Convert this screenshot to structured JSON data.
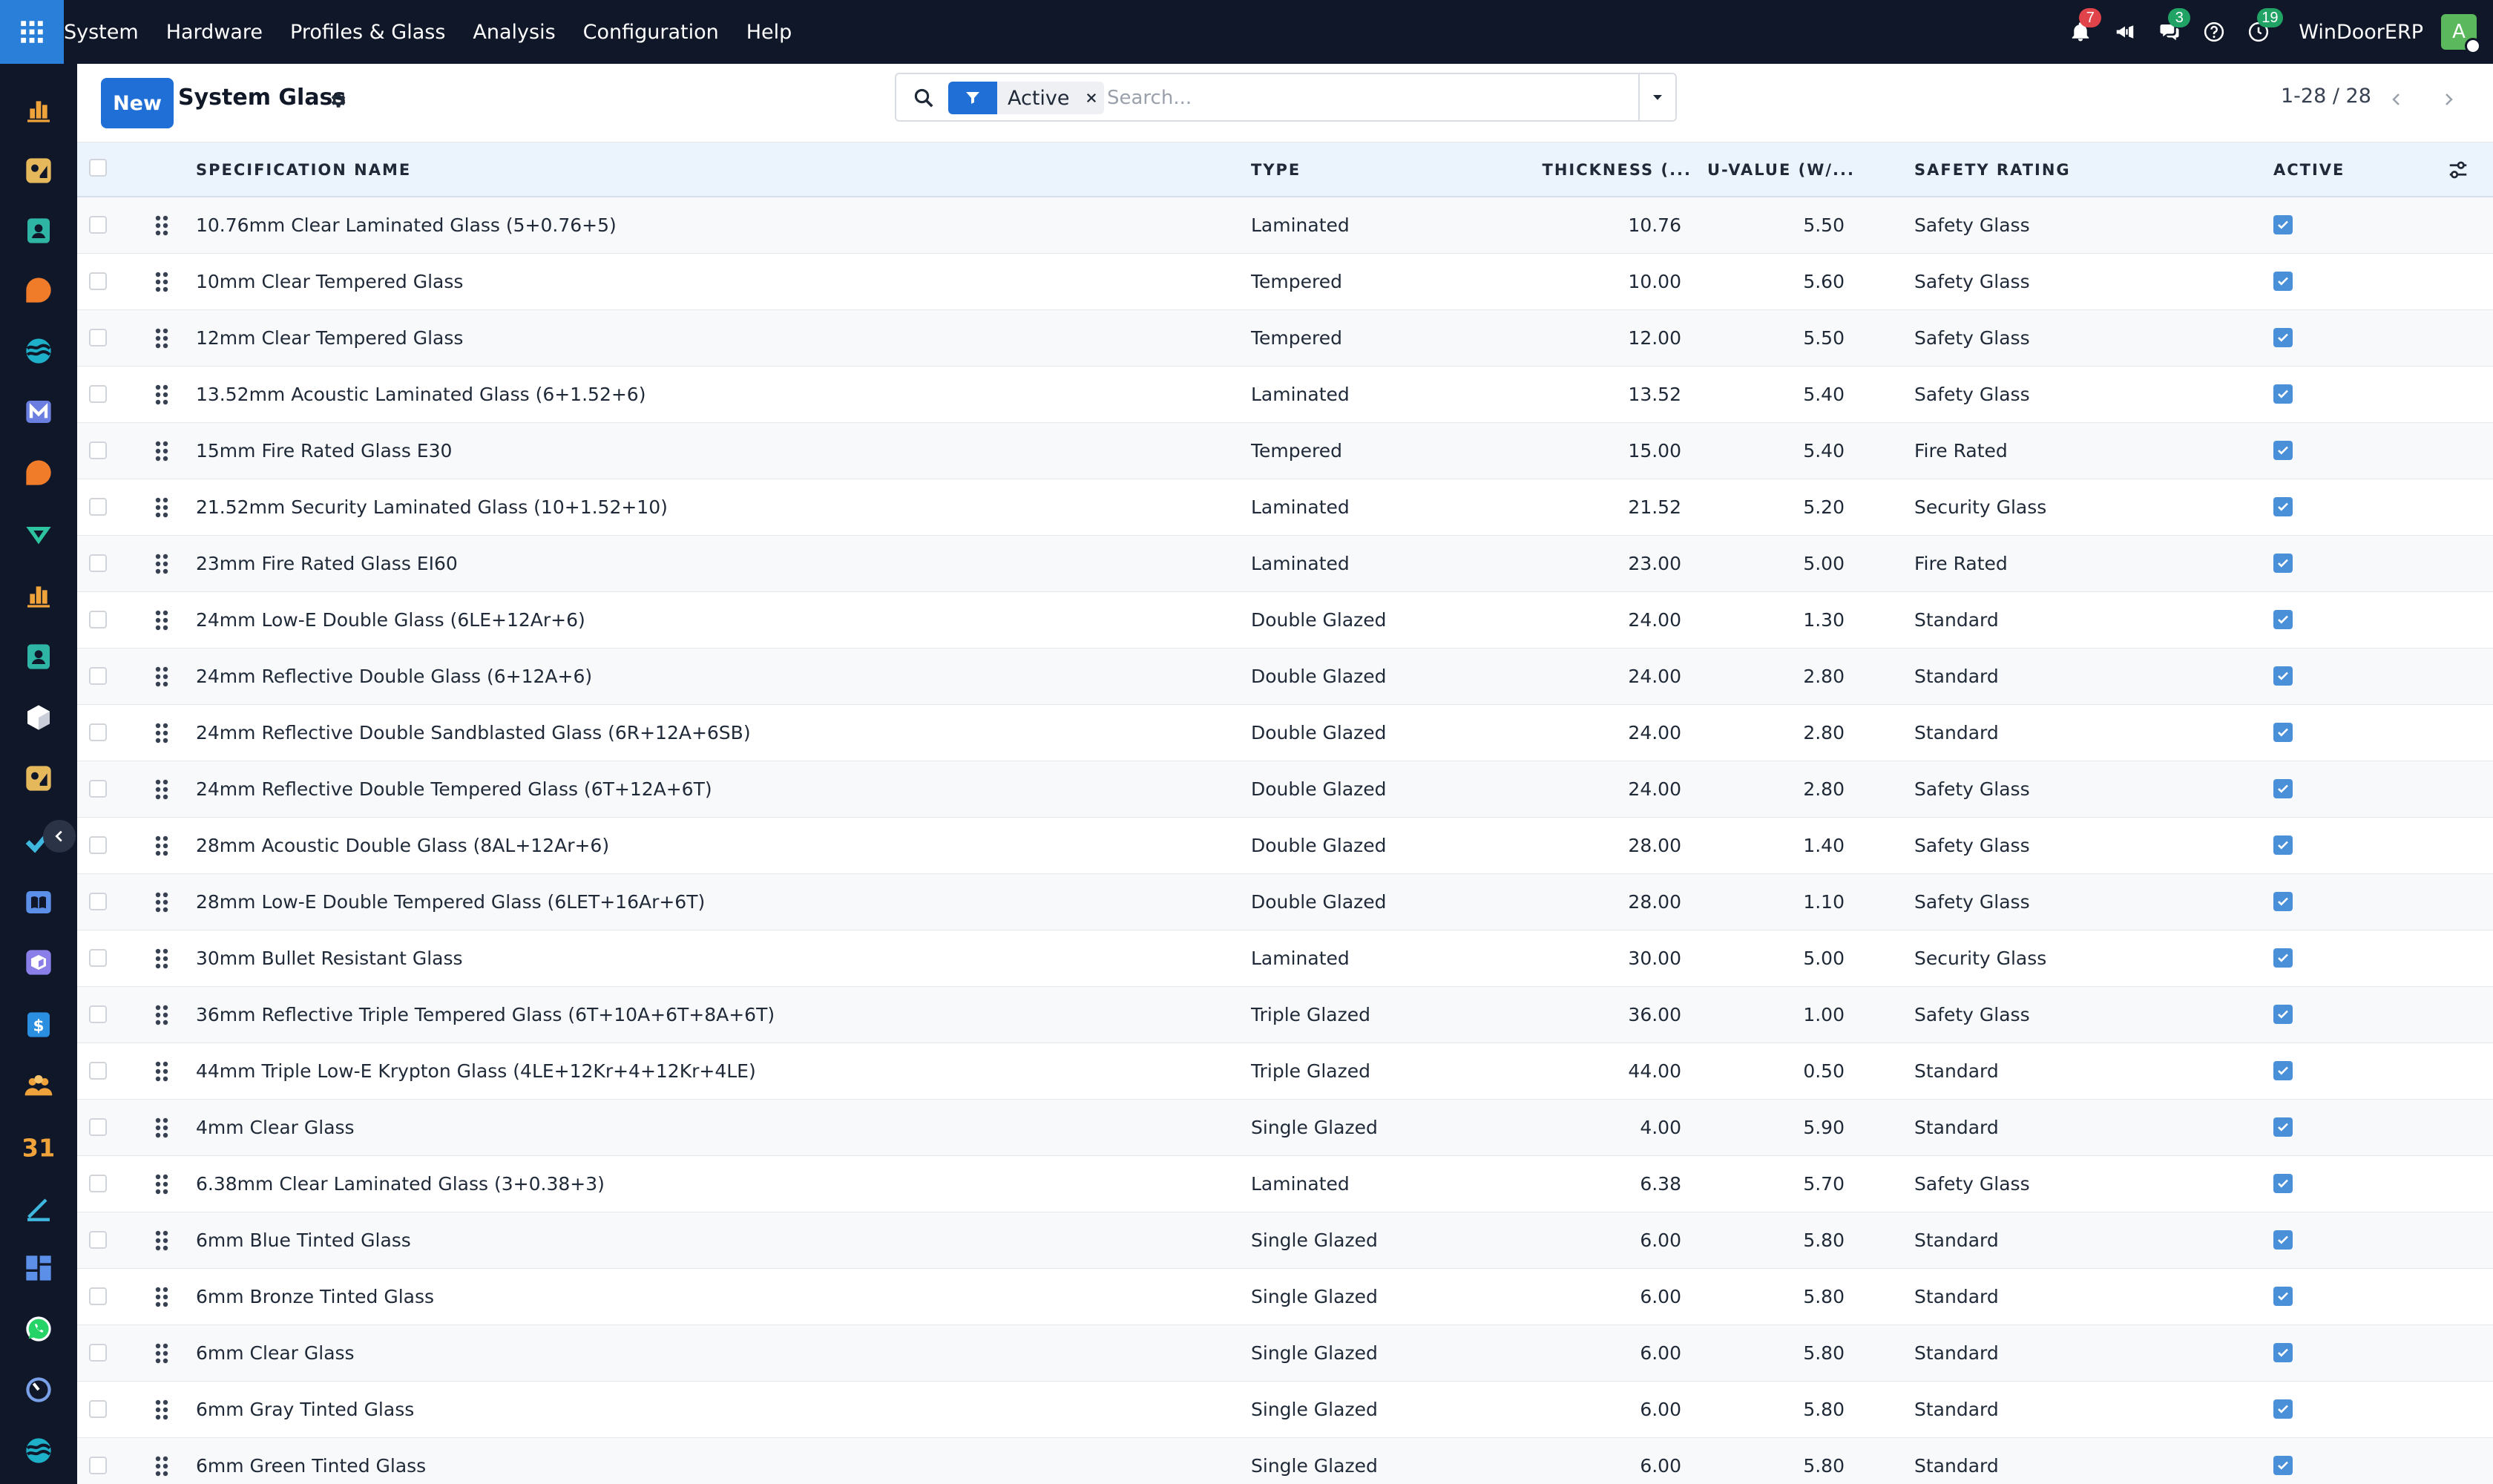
{
  "navbar": {
    "menu": [
      "System",
      "Hardware",
      "Profiles & Glass",
      "Analysis",
      "Configuration",
      "Help"
    ],
    "notification_count": "7",
    "messages_count": "3",
    "activity_count": "19",
    "company": "WinDoorERP",
    "avatar_initial": "A"
  },
  "rail": {
    "apps": [
      {
        "icon": "bar-chart-icon",
        "color": "#f0a33a"
      },
      {
        "icon": "palette-icon",
        "color": "#e6b85c"
      },
      {
        "icon": "contacts-icon",
        "color": "#2fb5a3"
      },
      {
        "icon": "chat-bubble-icon",
        "color": "#f07c2a"
      },
      {
        "icon": "wave-icon",
        "color": "#1fb0c9"
      },
      {
        "icon": "mail-icon",
        "color": "#6b7fe0"
      },
      {
        "icon": "chat-bubble-icon",
        "color": "#f07c2a"
      },
      {
        "icon": "plane-icon",
        "color": "#2ec4a0"
      },
      {
        "icon": "bar-chart-icon",
        "color": "#f0a33a"
      },
      {
        "icon": "contacts-icon",
        "color": "#2fb5a3"
      },
      {
        "icon": "cube-icon",
        "color": "#ffffff"
      },
      {
        "icon": "palette-icon",
        "color": "#e6b85c"
      },
      {
        "icon": "check-icon",
        "color": "#3fb8e0"
      },
      {
        "icon": "book-icon",
        "color": "#5b8fe8"
      },
      {
        "icon": "box-icon",
        "color": "#8a7fe8"
      },
      {
        "icon": "invoice-icon",
        "color": "#2a8fe0"
      },
      {
        "icon": "team-icon",
        "color": "#f0a33a"
      },
      {
        "icon": "calendar-icon",
        "color": "#f0a33a"
      },
      {
        "icon": "pen-icon",
        "color": "#3fb8e0"
      },
      {
        "icon": "dashboard-icon",
        "color": "#5b8fe8"
      },
      {
        "icon": "whatsapp-icon",
        "color": "#25d366"
      },
      {
        "icon": "timer-icon",
        "color": "#7aa0e8"
      },
      {
        "icon": "wave-icon",
        "color": "#1fb0c9"
      }
    ]
  },
  "control": {
    "new_label": "New",
    "title": "System Glass",
    "facet_label": "Active",
    "search_placeholder": "Search...",
    "pager": "1-28 / 28"
  },
  "table": {
    "columns": {
      "name": "SPECIFICATION NAME",
      "type": "TYPE",
      "thickness": "THICKNESS (...",
      "uvalue": "U-VALUE (W/...",
      "safety": "SAFETY RATING",
      "active": "ACTIVE"
    },
    "rows": [
      {
        "name": "10.76mm Clear Laminated Glass (5+0.76+5)",
        "type": "Laminated",
        "thickness": "10.76",
        "uvalue": "5.50",
        "safety": "Safety Glass",
        "active": true
      },
      {
        "name": "10mm Clear Tempered Glass",
        "type": "Tempered",
        "thickness": "10.00",
        "uvalue": "5.60",
        "safety": "Safety Glass",
        "active": true
      },
      {
        "name": "12mm Clear Tempered Glass",
        "type": "Tempered",
        "thickness": "12.00",
        "uvalue": "5.50",
        "safety": "Safety Glass",
        "active": true
      },
      {
        "name": "13.52mm Acoustic Laminated Glass (6+1.52+6)",
        "type": "Laminated",
        "thickness": "13.52",
        "uvalue": "5.40",
        "safety": "Safety Glass",
        "active": true
      },
      {
        "name": "15mm Fire Rated Glass E30",
        "type": "Tempered",
        "thickness": "15.00",
        "uvalue": "5.40",
        "safety": "Fire Rated",
        "active": true
      },
      {
        "name": "21.52mm Security Laminated Glass (10+1.52+10)",
        "type": "Laminated",
        "thickness": "21.52",
        "uvalue": "5.20",
        "safety": "Security Glass",
        "active": true
      },
      {
        "name": "23mm Fire Rated Glass EI60",
        "type": "Laminated",
        "thickness": "23.00",
        "uvalue": "5.00",
        "safety": "Fire Rated",
        "active": true
      },
      {
        "name": "24mm Low-E Double Glass (6LE+12Ar+6)",
        "type": "Double Glazed",
        "thickness": "24.00",
        "uvalue": "1.30",
        "safety": "Standard",
        "active": true
      },
      {
        "name": "24mm Reflective Double Glass (6+12A+6)",
        "type": "Double Glazed",
        "thickness": "24.00",
        "uvalue": "2.80",
        "safety": "Standard",
        "active": true
      },
      {
        "name": "24mm Reflective Double Sandblasted Glass (6R+12A+6SB)",
        "type": "Double Glazed",
        "thickness": "24.00",
        "uvalue": "2.80",
        "safety": "Standard",
        "active": true
      },
      {
        "name": "24mm Reflective Double Tempered Glass (6T+12A+6T)",
        "type": "Double Glazed",
        "thickness": "24.00",
        "uvalue": "2.80",
        "safety": "Safety Glass",
        "active": true
      },
      {
        "name": "28mm Acoustic Double Glass (8AL+12Ar+6)",
        "type": "Double Glazed",
        "thickness": "28.00",
        "uvalue": "1.40",
        "safety": "Safety Glass",
        "active": true
      },
      {
        "name": "28mm Low-E Double Tempered Glass (6LET+16Ar+6T)",
        "type": "Double Glazed",
        "thickness": "28.00",
        "uvalue": "1.10",
        "safety": "Safety Glass",
        "active": true
      },
      {
        "name": "30mm Bullet Resistant Glass",
        "type": "Laminated",
        "thickness": "30.00",
        "uvalue": "5.00",
        "safety": "Security Glass",
        "active": true
      },
      {
        "name": "36mm Reflective Triple Tempered Glass (6T+10A+6T+8A+6T)",
        "type": "Triple Glazed",
        "thickness": "36.00",
        "uvalue": "1.00",
        "safety": "Safety Glass",
        "active": true
      },
      {
        "name": "44mm Triple Low-E Krypton Glass (4LE+12Kr+4+12Kr+4LE)",
        "type": "Triple Glazed",
        "thickness": "44.00",
        "uvalue": "0.50",
        "safety": "Standard",
        "active": true
      },
      {
        "name": "4mm Clear Glass",
        "type": "Single Glazed",
        "thickness": "4.00",
        "uvalue": "5.90",
        "safety": "Standard",
        "active": true
      },
      {
        "name": "6.38mm Clear Laminated Glass (3+0.38+3)",
        "type": "Laminated",
        "thickness": "6.38",
        "uvalue": "5.70",
        "safety": "Safety Glass",
        "active": true
      },
      {
        "name": "6mm Blue Tinted Glass",
        "type": "Single Glazed",
        "thickness": "6.00",
        "uvalue": "5.80",
        "safety": "Standard",
        "active": true
      },
      {
        "name": "6mm Bronze Tinted Glass",
        "type": "Single Glazed",
        "thickness": "6.00",
        "uvalue": "5.80",
        "safety": "Standard",
        "active": true
      },
      {
        "name": "6mm Clear Glass",
        "type": "Single Glazed",
        "thickness": "6.00",
        "uvalue": "5.80",
        "safety": "Standard",
        "active": true
      },
      {
        "name": "6mm Gray Tinted Glass",
        "type": "Single Glazed",
        "thickness": "6.00",
        "uvalue": "5.80",
        "safety": "Standard",
        "active": true
      },
      {
        "name": "6mm Green Tinted Glass",
        "type": "Single Glazed",
        "thickness": "6.00",
        "uvalue": "5.80",
        "safety": "Standard",
        "active": true
      }
    ]
  },
  "colors": {
    "navbar": "#0f1729",
    "primary": "#1f6fd6",
    "header_bg": "#ebf3fc",
    "checkbox_active": "#4a90d9"
  }
}
